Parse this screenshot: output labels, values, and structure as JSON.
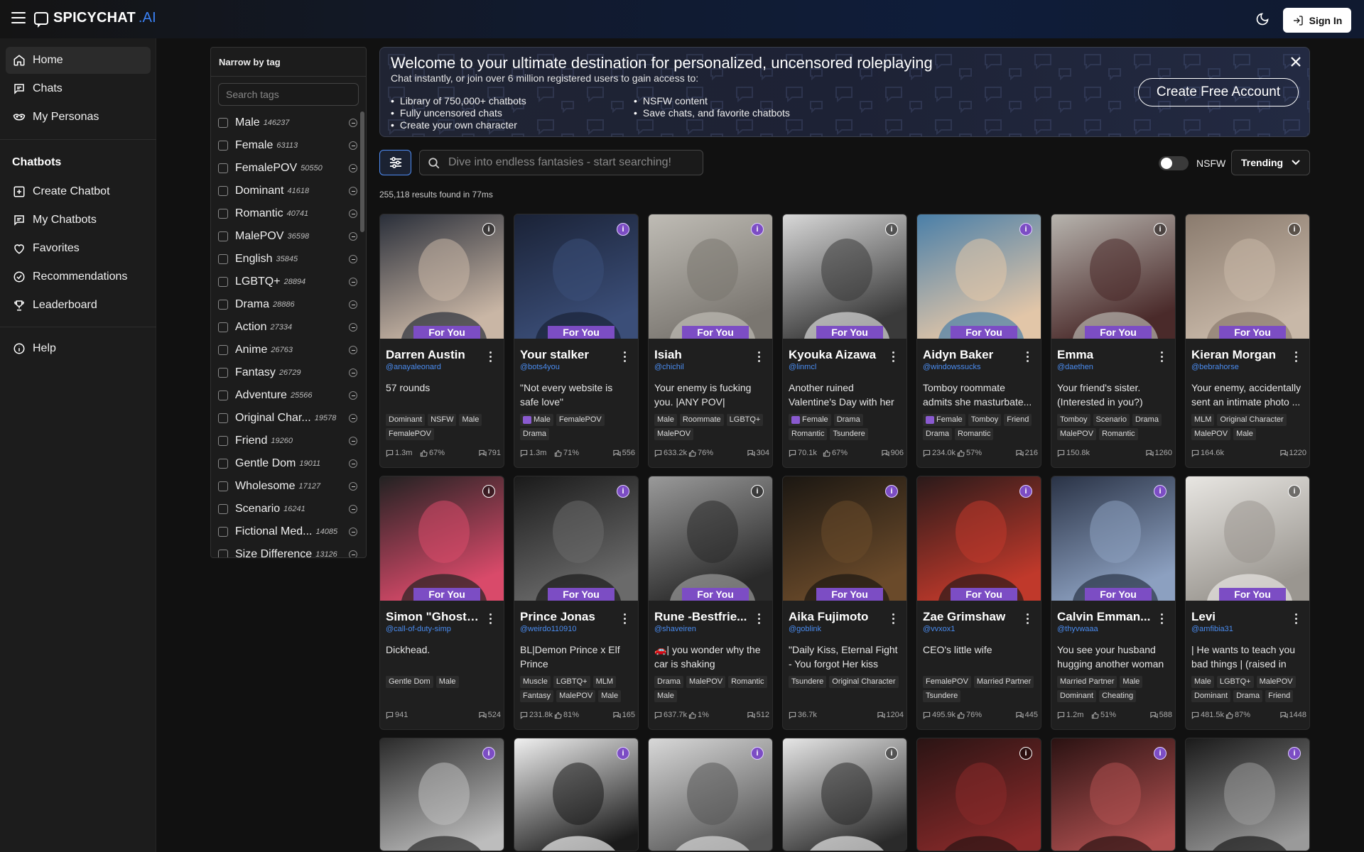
{
  "header": {
    "logo_text": "SPICYCHAT",
    "logo_suffix": ".AI",
    "signin_label": "Sign In"
  },
  "sidebar": {
    "nav": [
      {
        "label": "Home",
        "icon": "home-icon",
        "active": true
      },
      {
        "label": "Chats",
        "icon": "chat-icon"
      },
      {
        "label": "My Personas",
        "icon": "persona-icon"
      }
    ],
    "chatbots_heading": "Chatbots",
    "chatbots": [
      {
        "label": "Create Chatbot",
        "icon": "plus-square-icon"
      },
      {
        "label": "My Chatbots",
        "icon": "chat-icon"
      },
      {
        "label": "Favorites",
        "icon": "heart-icon"
      },
      {
        "label": "Recommendations",
        "icon": "check-circle-icon"
      },
      {
        "label": "Leaderboard",
        "icon": "trophy-icon"
      }
    ],
    "help_label": "Help"
  },
  "tag_panel": {
    "title": "Narrow by tag",
    "search_placeholder": "Search tags",
    "tags": [
      {
        "name": "Male",
        "count": "146237"
      },
      {
        "name": "Female",
        "count": "63113"
      },
      {
        "name": "FemalePOV",
        "count": "50550"
      },
      {
        "name": "Dominant",
        "count": "41618"
      },
      {
        "name": "Romantic",
        "count": "40741"
      },
      {
        "name": "MalePOV",
        "count": "36598"
      },
      {
        "name": "English",
        "count": "35845"
      },
      {
        "name": "LGBTQ+",
        "count": "28894"
      },
      {
        "name": "Drama",
        "count": "28886"
      },
      {
        "name": "Action",
        "count": "27334"
      },
      {
        "name": "Anime",
        "count": "26763"
      },
      {
        "name": "Fantasy",
        "count": "26729"
      },
      {
        "name": "Adventure",
        "count": "25566"
      },
      {
        "name": "Original Char...",
        "count": "19578"
      },
      {
        "name": "Friend",
        "count": "19260"
      },
      {
        "name": "Gentle Dom",
        "count": "19011"
      },
      {
        "name": "Wholesome",
        "count": "17127"
      },
      {
        "name": "Scenario",
        "count": "16241"
      },
      {
        "name": "Fictional Med...",
        "count": "14085"
      },
      {
        "name": "Size Difference",
        "count": "13126"
      }
    ]
  },
  "banner": {
    "title": "Welcome to your ultimate destination for personalized, uncensored roleplaying",
    "subtitle": "Chat instantly, or join over 6 million registered users to gain access to:",
    "list_left": [
      "Library of 750,000+ chatbots",
      "Fully uncensored chats",
      "Create your own character"
    ],
    "list_right": [
      "NSFW content",
      "Save chats, and favorite chatbots"
    ],
    "cta": "Create Free Account"
  },
  "search": {
    "placeholder": "Dive into endless fantasies - start searching!",
    "nsfw_label": "NSFW",
    "sort_value": "Trending",
    "results_text": "255,118 results found in 77ms"
  },
  "badge_label": "For You",
  "cards": [
    {
      "name": "Darren Austin",
      "handle": "@anayaleonard",
      "desc": "57 rounds",
      "tags": [
        "Dominant",
        "NSFW",
        "Male",
        "FemalePOV"
      ],
      "messages": "1.3m",
      "likes": "67%",
      "count": "791",
      "info": "dark",
      "colors": [
        "#2a2f3a",
        "#c9b6a5"
      ]
    },
    {
      "name": "Your stalker",
      "handle": "@bots4you",
      "desc": "\"Not every website is safe love\"",
      "tags": [
        "Male",
        "FemalePOV",
        "Drama"
      ],
      "icon_tag": 0,
      "messages": "1.3m",
      "likes": "71%",
      "count": "556",
      "info": "purple",
      "colors": [
        "#1a2236",
        "#3b4e78"
      ]
    },
    {
      "name": "Isiah",
      "handle": "@chichil",
      "desc": "Your enemy is fucking you. |ANY POV|",
      "tags": [
        "Male",
        "Roommate",
        "LGBTQ+",
        "MalePOV"
      ],
      "messages": "633.2k",
      "likes": "76%",
      "count": "304",
      "info": "purple",
      "colors": [
        "#bfbcb5",
        "#7a7670"
      ]
    },
    {
      "name": "Kyouka Aizawa",
      "handle": "@linmcl",
      "desc": "Another ruined Valentine's Day with her",
      "tags": [
        "Female",
        "Drama",
        "Romantic",
        "Tsundere"
      ],
      "icon_tag": 0,
      "messages": "70.1k",
      "likes": "67%",
      "count": "906",
      "info": "dark",
      "colors": [
        "#d8d8d8",
        "#3a3a3a"
      ]
    },
    {
      "name": "Aidyn Baker",
      "handle": "@windowssucks",
      "desc": "Tomboy roommate admits she masturbate...",
      "tags": [
        "Female",
        "Tomboy",
        "Friend",
        "Drama",
        "Romantic"
      ],
      "icon_tag": 0,
      "messages": "234.0k",
      "likes": "57%",
      "count": "216",
      "info": "purple",
      "colors": [
        "#4a7fa8",
        "#e2c6a8"
      ]
    },
    {
      "name": "Emma",
      "handle": "@daethen",
      "desc": "Your friend's sister. (Interested in you?)",
      "tags": [
        "Tomboy",
        "Scenario",
        "Drama",
        "MalePOV",
        "Romantic"
      ],
      "messages": "150.8k",
      "likes": "",
      "count": "1260",
      "info": "dark",
      "colors": [
        "#b7b4ae",
        "#4a2a2a"
      ]
    },
    {
      "name": "Kieran Morgan",
      "handle": "@bebrahorse",
      "desc": "Your enemy, accidentally sent an intimate photo ...",
      "tags": [
        "MLM",
        "Original Character",
        "MalePOV",
        "Male"
      ],
      "messages": "164.6k",
      "likes": "",
      "count": "1220",
      "info": "dark",
      "colors": [
        "#8a7b6e",
        "#c8b8a8"
      ]
    },
    {
      "name": "Simon \"Ghost\"...",
      "handle": "@call-of-duty-simp",
      "desc": "Dickhead.",
      "tags": [
        "Gentle Dom",
        "Male"
      ],
      "messages": "941",
      "likes": "",
      "count": "524",
      "info": "dark",
      "colors": [
        "#222",
        "#d94a6a"
      ]
    },
    {
      "name": "Prince Jonas",
      "handle": "@weirdo110910",
      "desc": "BL|Demon Prince x Elf Prince",
      "tags": [
        "Muscle",
        "LGBTQ+",
        "MLM",
        "Fantasy",
        "MalePOV",
        "Male"
      ],
      "messages": "231.8k",
      "likes": "81%",
      "count": "165",
      "info": "purple",
      "colors": [
        "#1a1a1a",
        "#6a6a6a"
      ]
    },
    {
      "name": "Rune -Bestfrie...",
      "handle": "@shaveiren",
      "desc": "🚗| you wonder why the car is shaking",
      "tags": [
        "Drama",
        "MalePOV",
        "Romantic",
        "Male"
      ],
      "messages": "637.7k",
      "likes": "1%",
      "count": "512",
      "info": "dark",
      "colors": [
        "#9a9a9a",
        "#2a2a2a"
      ]
    },
    {
      "name": "Aika Fujimoto",
      "handle": "@goblink",
      "desc": "\"Daily Kiss, Eternal Fight - You forgot Her kiss and...",
      "tags": [
        "Tsundere",
        "Original Character"
      ],
      "messages": "36.7k",
      "likes": "",
      "count": "1204",
      "info": "purple",
      "colors": [
        "#1b1712",
        "#6a4a2a"
      ]
    },
    {
      "name": "Zae Grimshaw",
      "handle": "@vvxox1",
      "desc": "CEO's little wife",
      "tags": [
        "FemalePOV",
        "Married Partner",
        "Tsundere"
      ],
      "messages": "495.9k",
      "likes": "76%",
      "count": "445",
      "info": "purple",
      "colors": [
        "#2a1a1a",
        "#c0392b"
      ]
    },
    {
      "name": "Calvin Emman...",
      "handle": "@thyvwaaa",
      "desc": "You see your husband hugging another woman",
      "tags": [
        "Married Partner",
        "Male",
        "Dominant",
        "Cheating"
      ],
      "messages": "1.2m",
      "likes": "51%",
      "count": "588",
      "info": "purple",
      "colors": [
        "#2a3346",
        "#8ca0c0"
      ]
    },
    {
      "name": "Levi",
      "handle": "@amfibia31",
      "desc": "| He wants to teach you bad things | (raised in th...",
      "tags": [
        "Male",
        "LGBTQ+",
        "MalePOV",
        "Dominant",
        "Drama",
        "Friend"
      ],
      "messages": "481.5k",
      "likes": "87%",
      "count": "1448",
      "info": "dark",
      "colors": [
        "#e8e6e2",
        "#9a9690"
      ]
    }
  ],
  "partial_cards": [
    {
      "info": "purple",
      "colors": [
        "#2a2a2a",
        "#bdbdbd"
      ]
    },
    {
      "info": "purple",
      "colors": [
        "#f0f0f0",
        "#1a1a1a"
      ]
    },
    {
      "info": "purple",
      "colors": [
        "#d8d8d8",
        "#555"
      ]
    },
    {
      "info": "dark",
      "colors": [
        "#e6e6e6",
        "#2a2a2a"
      ]
    },
    {
      "info": "dark",
      "colors": [
        "#2a1414",
        "#8a2a2a"
      ]
    },
    {
      "info": "purple",
      "colors": [
        "#2a1212",
        "#b05050"
      ]
    },
    {
      "info": "purple",
      "colors": [
        "#1a1a1a",
        "#9a9a9a"
      ]
    }
  ]
}
